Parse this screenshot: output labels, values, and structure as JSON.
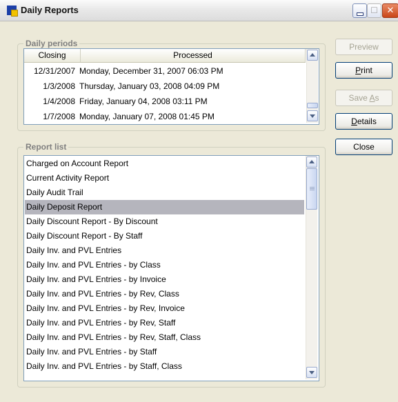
{
  "window": {
    "title": "Daily Reports"
  },
  "daily_periods": {
    "title": "Daily periods",
    "columns": [
      "Closing",
      "Processed"
    ],
    "rows": [
      {
        "closing": "12/31/2007",
        "processed": "Monday, December 31, 2007 06:03 PM"
      },
      {
        "closing": "1/3/2008",
        "processed": "Thursday, January 03, 2008 04:09 PM"
      },
      {
        "closing": "1/4/2008",
        "processed": "Friday, January 04, 2008 03:11 PM"
      },
      {
        "closing": "1/7/2008",
        "processed": "Monday, January 07, 2008 01:45 PM"
      }
    ]
  },
  "report_list": {
    "title": "Report list",
    "selected_index": 3,
    "items": [
      "Charged on Account Report",
      "Current Activity Report",
      "Daily Audit Trail",
      "Daily Deposit Report",
      "Daily Discount Report - By Discount",
      "Daily Discount Report - By Staff",
      "Daily Inv. and PVL Entries",
      "Daily Inv. and PVL Entries - by Class",
      "Daily Inv. and PVL Entries - by Invoice",
      "Daily Inv. and PVL Entries - by Rev, Class",
      "Daily Inv. and PVL Entries - by Rev, Invoice",
      "Daily Inv. and PVL Entries - by Rev, Staff",
      "Daily Inv. and PVL Entries - by Rev, Staff, Class",
      "Daily Inv. and PVL Entries - by Staff",
      "Daily Inv. and PVL Entries - by Staff, Class"
    ]
  },
  "buttons": {
    "preview": {
      "label": "Preview",
      "enabled": false
    },
    "print": {
      "pre": "",
      "key": "P",
      "post": "rint",
      "enabled": true
    },
    "save_as": {
      "pre": "Save ",
      "key": "A",
      "post": "s",
      "enabled": false
    },
    "details": {
      "pre": "",
      "key": "D",
      "post": "etails",
      "enabled": true
    },
    "close": {
      "label": "Close",
      "enabled": true
    }
  },
  "icons": [
    "app-icon",
    "minimize-icon",
    "maximize-icon",
    "close-icon",
    "scroll-up-icon",
    "scroll-down-icon"
  ]
}
